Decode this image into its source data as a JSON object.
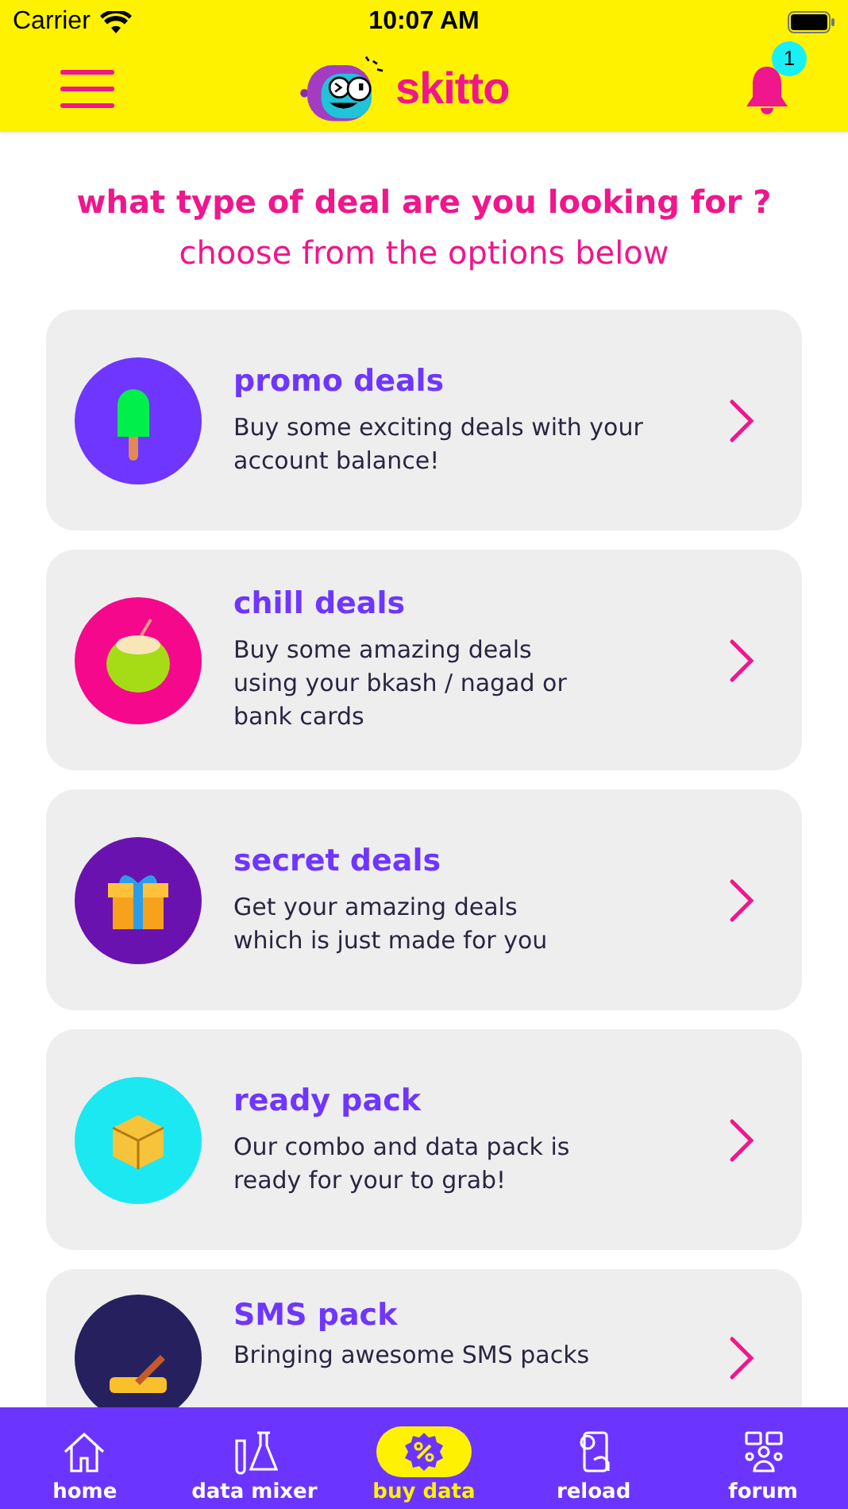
{
  "status_bar": {
    "carrier": "Carrier",
    "time": "10:07 AM"
  },
  "header": {
    "brand": "skitto",
    "notification_count": "1"
  },
  "heading": {
    "title": "what type of deal are you looking for ?",
    "subtitle": "choose from the options below"
  },
  "deals": [
    {
      "title": "promo deals",
      "description": "Buy some exciting deals with your account balance!",
      "color": "#6e36ff"
    },
    {
      "title": "chill deals",
      "description": "Buy some amazing deals using your bkash / nagad or bank cards",
      "color": "#f5088c"
    },
    {
      "title": "secret deals",
      "description": "Get your amazing deals which is just made for you",
      "color": "#6a12b0"
    },
    {
      "title": "ready pack",
      "description": "Our combo and data pack is ready for your to grab!",
      "color": "#1ce8f2"
    },
    {
      "title": "SMS pack",
      "description": "Bringing awesome SMS packs",
      "color": "#27205e"
    }
  ],
  "tab_bar": [
    {
      "label": "home",
      "selected": false
    },
    {
      "label": "data mixer",
      "selected": false
    },
    {
      "label": "buy data",
      "selected": true
    },
    {
      "label": "reload",
      "selected": false
    },
    {
      "label": "forum",
      "selected": false
    }
  ]
}
